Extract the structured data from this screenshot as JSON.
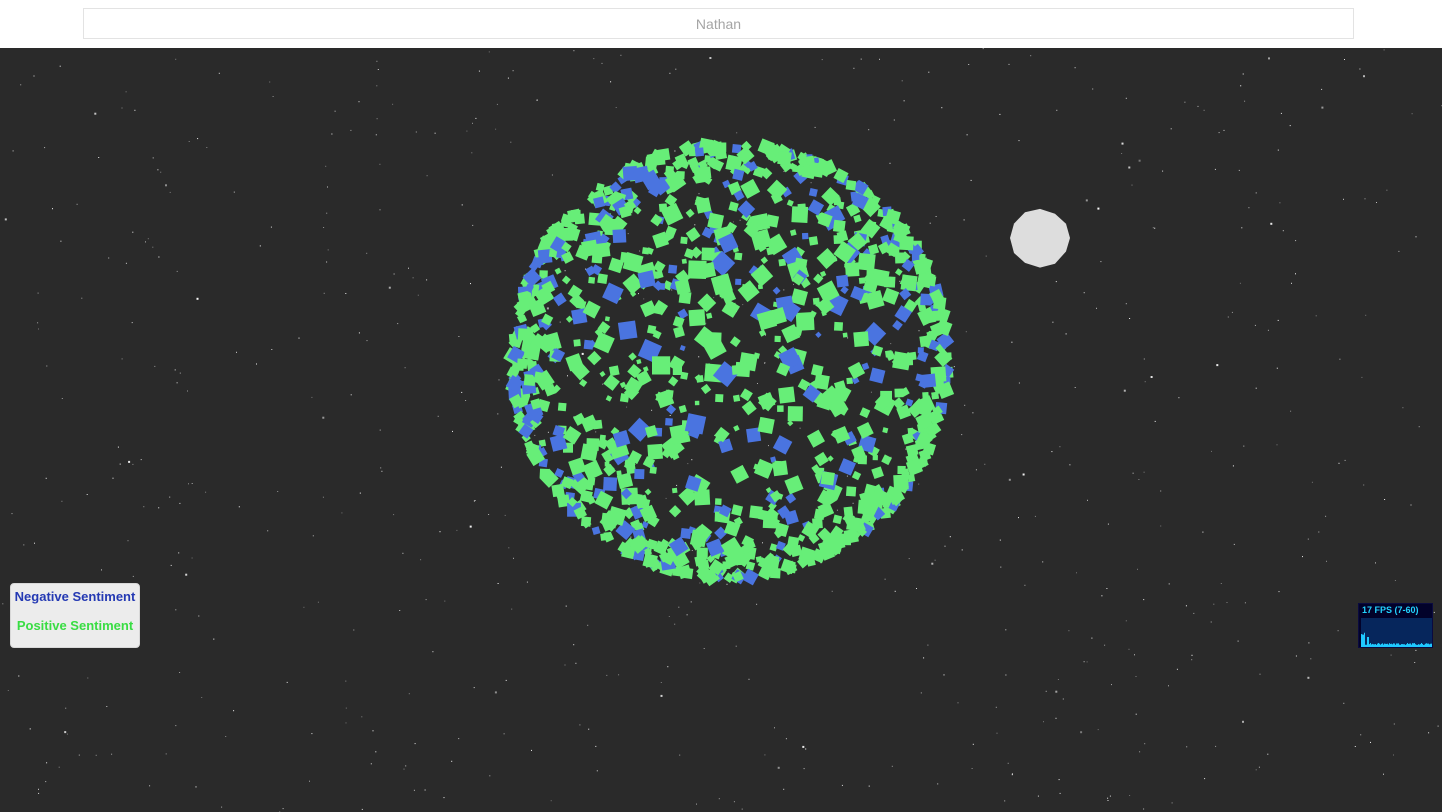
{
  "search": {
    "placeholder": "Nathan"
  },
  "legend": {
    "negative_label": "Negative Sentiment",
    "positive_label": "Positive Sentiment"
  },
  "stats": {
    "fps_text": "17 FPS (7-60)"
  },
  "colors": {
    "background": "#2a2a2a",
    "negative": "#4a74e0",
    "positive": "#67ee78",
    "moon": "#dddddd",
    "stars": "#ffffff"
  }
}
